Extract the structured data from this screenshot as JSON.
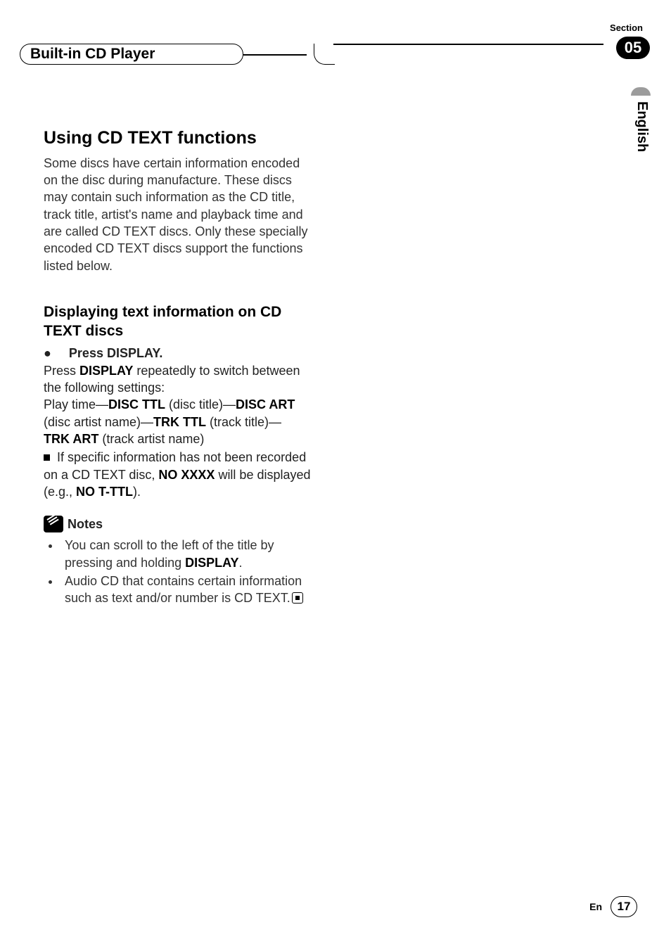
{
  "header": {
    "chapter_title": "Built-in CD Player",
    "section_label": "Section",
    "section_number": "05"
  },
  "side_tab": "English",
  "content": {
    "heading": "Using CD TEXT functions",
    "intro": "Some discs have certain information encoded on the disc during manufacture. These discs may contain such information as the CD title, track title, artist's name and playback time and are called CD TEXT discs. Only these specially encoded CD TEXT discs support the functions listed below.",
    "sub_heading": "Displaying text information on CD TEXT discs",
    "step_bullet": "●",
    "step_lead": "Press DISPLAY.",
    "step_body_1": "Press ",
    "step_body_bold_1": "DISPLAY",
    "step_body_2": " repeatedly to switch between the following settings:",
    "settings": {
      "line1_1": "Play time—",
      "line1_b1": "DISC TTL",
      "line1_2": " (disc title)—",
      "line1_b2": "DISC ART",
      "line2_1": "(disc artist name)—",
      "line2_b1": "TRK TTL",
      "line2_2": " (track title)—",
      "line3_b1": "TRK ART",
      "line3_1": " (track artist name)"
    },
    "note_line": {
      "part1": "If specific information has not been recorded on a CD TEXT disc, ",
      "bold1": "NO XXXX",
      "part2": " will be displayed (e.g., ",
      "bold2": "NO T-TTL",
      "part3": ")."
    },
    "notes_label": "Notes",
    "notes": [
      {
        "pre": "You can scroll to the left of the title by pressing and holding ",
        "bold": "DISPLAY",
        "post": "."
      },
      {
        "pre": "Audio CD that contains certain information such as text and/or number is CD TEXT.",
        "bold": "",
        "post": ""
      }
    ]
  },
  "footer": {
    "lang": "En",
    "page": "17"
  }
}
